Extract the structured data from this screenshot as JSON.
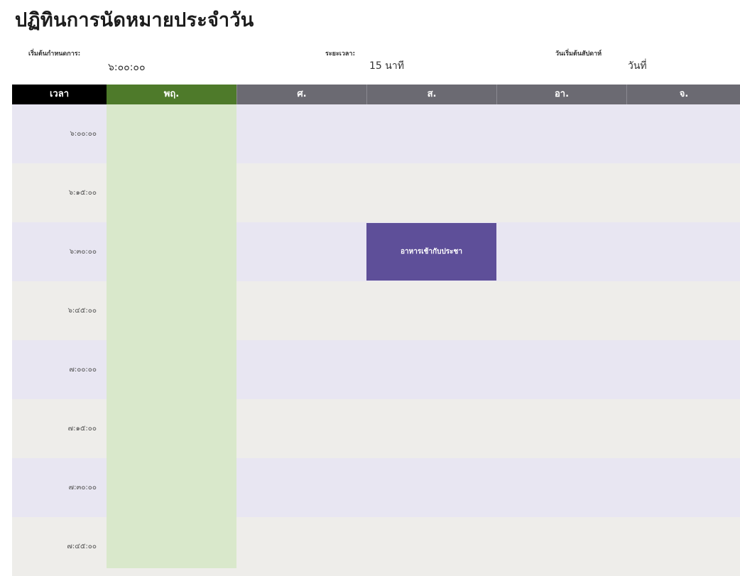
{
  "title": "ปฏิทินการนัดหมายประจำวัน",
  "meta": {
    "start_label": "เริ่มต้นกำหนดการ:",
    "start_value": "๖:๐๐:๐๐",
    "interval_label": "ระยะเวลา:",
    "interval_value": "15 นาที",
    "week_start_label": "วันเริ่มต้นสัปดาห์",
    "week_start_value": "วันที่"
  },
  "header": {
    "time_label": "เวลา",
    "days": [
      "พฤ.",
      "ศ.",
      "ส.",
      "อา.",
      "จ."
    ]
  },
  "times": [
    "๖:๐๐:๐๐",
    "๖:๑๕:๐๐",
    "๖:๓๐:๐๐",
    "๖:๔๕:๐๐",
    "๗:๐๐:๐๐",
    "๗:๑๕:๐๐",
    "๗:๓๐:๐๐",
    "๗:๔๕:๐๐"
  ],
  "event": {
    "label": "อาหารเช้ากับประชา",
    "color": "#5e4f99"
  },
  "colors": {
    "today_header": "#4e7a2a",
    "today_column": "#d9e8cb",
    "day_header": "#6b6a72"
  }
}
